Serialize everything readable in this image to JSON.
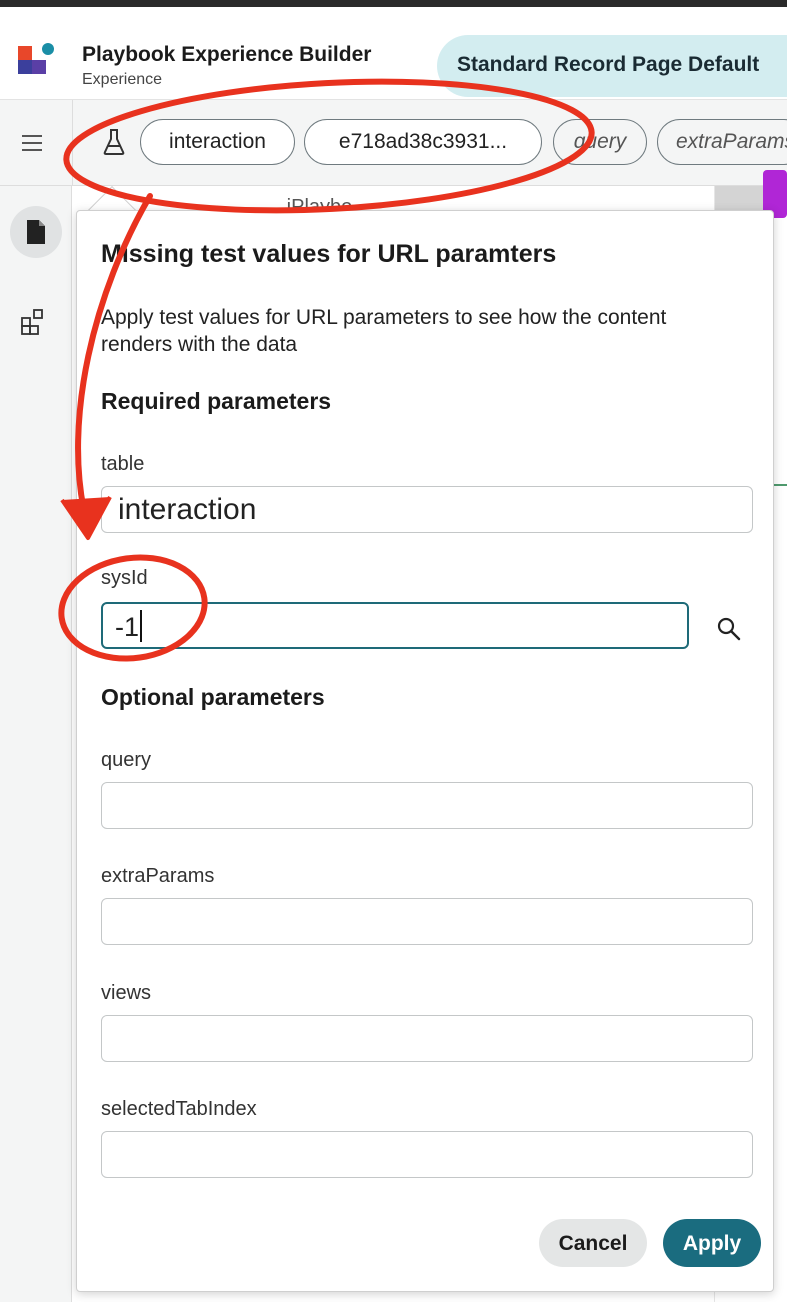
{
  "header": {
    "app_title": "Playbook Experience Builder",
    "app_subtitle": "Experience",
    "page_tab": "Standard Record Page Default"
  },
  "toolbar": {
    "chips": [
      "interaction",
      "e718ad38c3931...",
      "query",
      "extraParams"
    ]
  },
  "background": {
    "partial_text": "...iPlaybo..."
  },
  "popover": {
    "title": "Missing test values for URL paramters",
    "description": "Apply test values for URL parameters to see how the content renders with the data",
    "required_heading": "Required parameters",
    "optional_heading": "Optional parameters",
    "fields": {
      "table": {
        "label": "table",
        "value": "interaction"
      },
      "sysId": {
        "label": "sysId",
        "value": "-1"
      },
      "query": {
        "label": "query",
        "value": ""
      },
      "extraParams": {
        "label": "extraParams",
        "value": ""
      },
      "views": {
        "label": "views",
        "value": ""
      },
      "selectedTabIndex": {
        "label": "selectedTabIndex",
        "value": ""
      }
    },
    "cancel_label": "Cancel",
    "apply_label": "Apply"
  },
  "colors": {
    "accent": "#1a6c7f",
    "focus_border": "#1e6a78",
    "tab_bg": "#d3edf0",
    "annotation": "#e8321e",
    "purple_marker": "#b026d6"
  },
  "icons": [
    "logo-icon",
    "hamburger-icon",
    "flask-icon",
    "document-icon",
    "component-grid-icon",
    "search-icon"
  ]
}
